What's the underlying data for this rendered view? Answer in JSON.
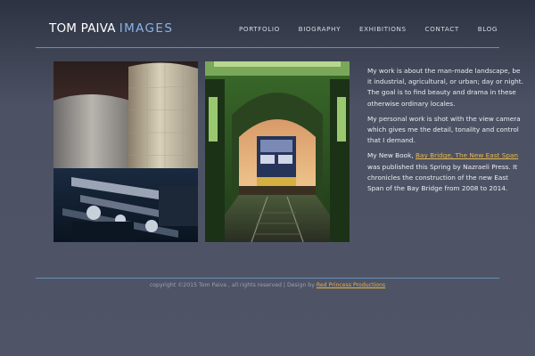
{
  "logo": {
    "name": "TOM PAIVA",
    "images": "IMAGES"
  },
  "nav": [
    "PORTFOLIO",
    "BIOGRAPHY",
    "EXHIBITIONS",
    "CONTACT",
    "BLOG"
  ],
  "intro": {
    "p1": "My work is about the man-made landscape, be it industrial, agricultural, or urban; day or night. The goal is to find beauty and drama in these otherwise ordinary locales.",
    "p2": "My personal work is shot with the view camera which gives me the detail, tonality and control that I demand.",
    "p3_before": "My New Book, ",
    "p3_link": "Bay Bridge, The New East Span",
    "p3_after": " was published this Spring by Nazraeli Press. It chronicles the construction of the new East Span of the Bay Bridge from 2008 to 2014."
  },
  "footer": {
    "text": "copyright ©2015 Tom Paiva , all rights reserved | Design by ",
    "link": "Red Princess Productions"
  },
  "colors": {
    "accent": "#8ab4e6",
    "link": "#e9b84a",
    "rule": "#6a8fb8"
  }
}
